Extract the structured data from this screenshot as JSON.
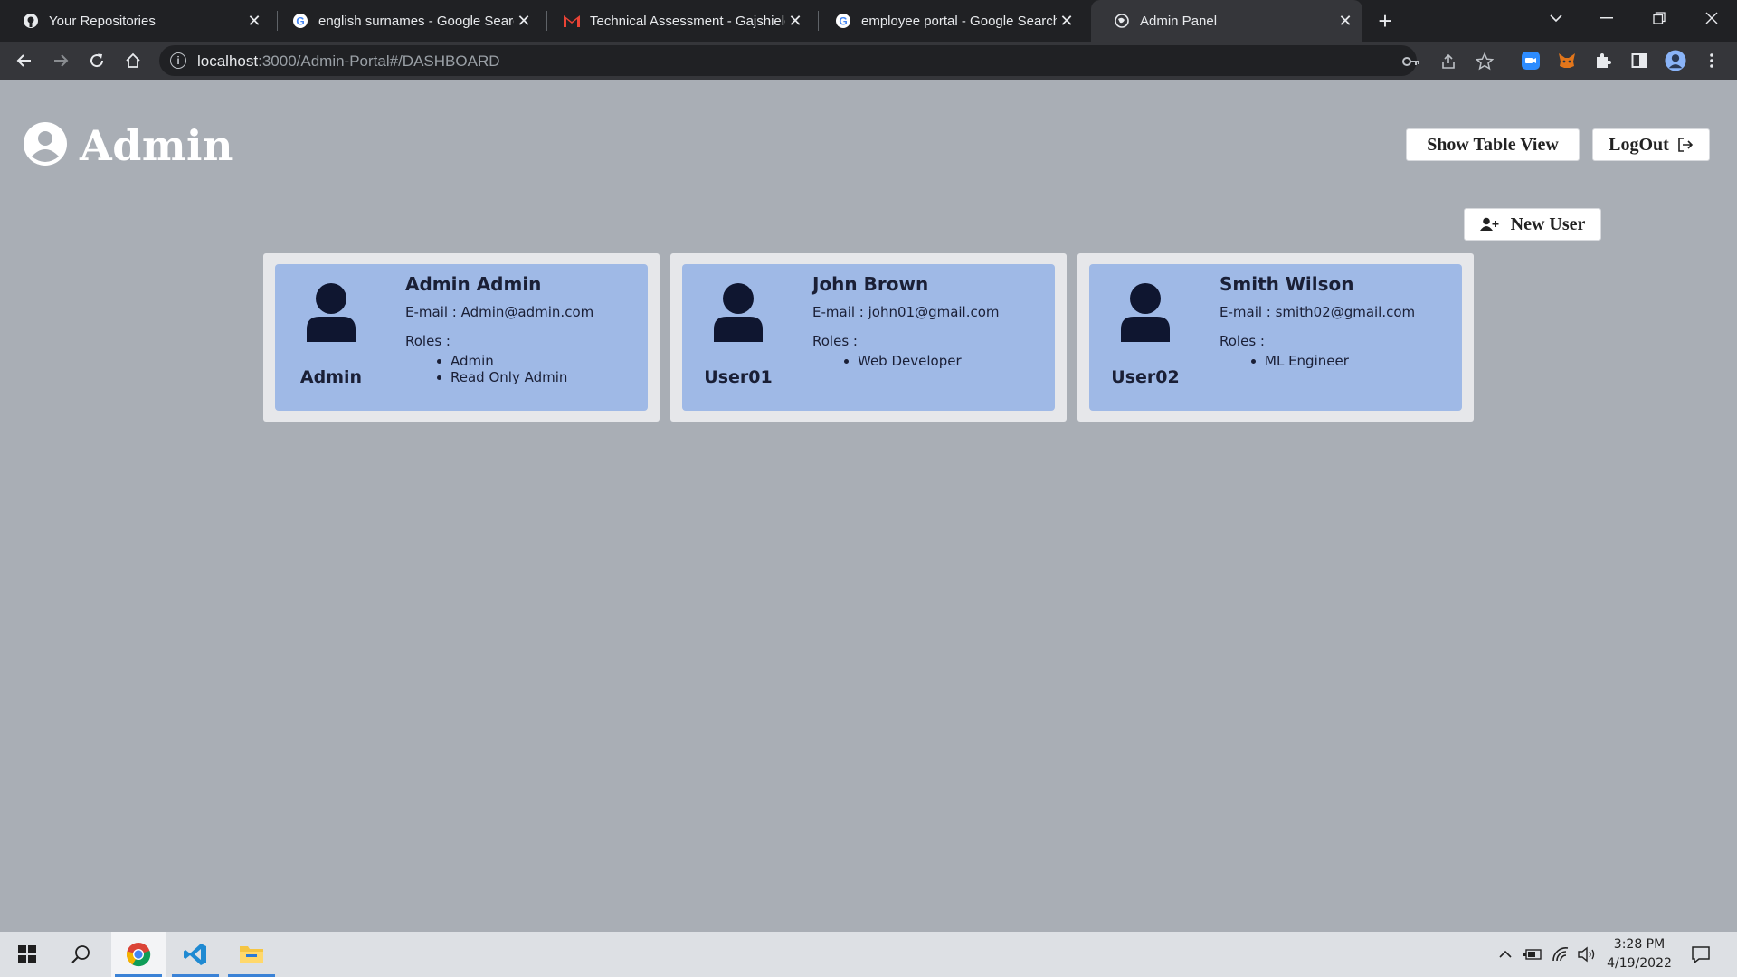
{
  "browser": {
    "tabs": [
      {
        "title": "Your Repositories",
        "icon": "github-icon",
        "active": false
      },
      {
        "title": "english surnames - Google Search",
        "icon": "google-icon",
        "active": false
      },
      {
        "title": "Technical Assessment - Gajshield",
        "icon": "gmail-icon",
        "active": false
      },
      {
        "title": "employee portal - Google Search",
        "icon": "google-icon",
        "active": false
      },
      {
        "title": "Admin Panel",
        "icon": "globe-icon",
        "active": true
      }
    ],
    "new_tab_label": "+",
    "url_host": "localhost",
    "url_path": ":3000/Admin-Portal#/DASHBOARD"
  },
  "header": {
    "title": "Admin",
    "show_table_view_label": "Show Table View",
    "logout_label": "LogOut"
  },
  "toolbar": {
    "new_user_label": "New User"
  },
  "users": [
    {
      "full_name": "Admin Admin",
      "username": "Admin",
      "email_label": "E-mail : Admin@admin.com",
      "roles_label": "Roles :",
      "roles": [
        "Admin",
        "Read Only Admin"
      ]
    },
    {
      "full_name": "John Brown",
      "username": "User01",
      "email_label": "E-mail : john01@gmail.com",
      "roles_label": "Roles :",
      "roles": [
        "Web Developer"
      ]
    },
    {
      "full_name": "Smith Wilson",
      "username": "User02",
      "email_label": "E-mail : smith02@gmail.com",
      "roles_label": "Roles :",
      "roles": [
        "ML Engineer"
      ]
    }
  ],
  "taskbar": {
    "time": "3:28 PM",
    "date": "4/19/2022"
  },
  "colors": {
    "page_background": "#a9aeb5",
    "card_background": "#9fb9e6",
    "card_frame": "#e6e7ea",
    "text_dark": "#1a1f36",
    "browser_dark": "#202124",
    "browser_toolbar": "#35363a"
  }
}
